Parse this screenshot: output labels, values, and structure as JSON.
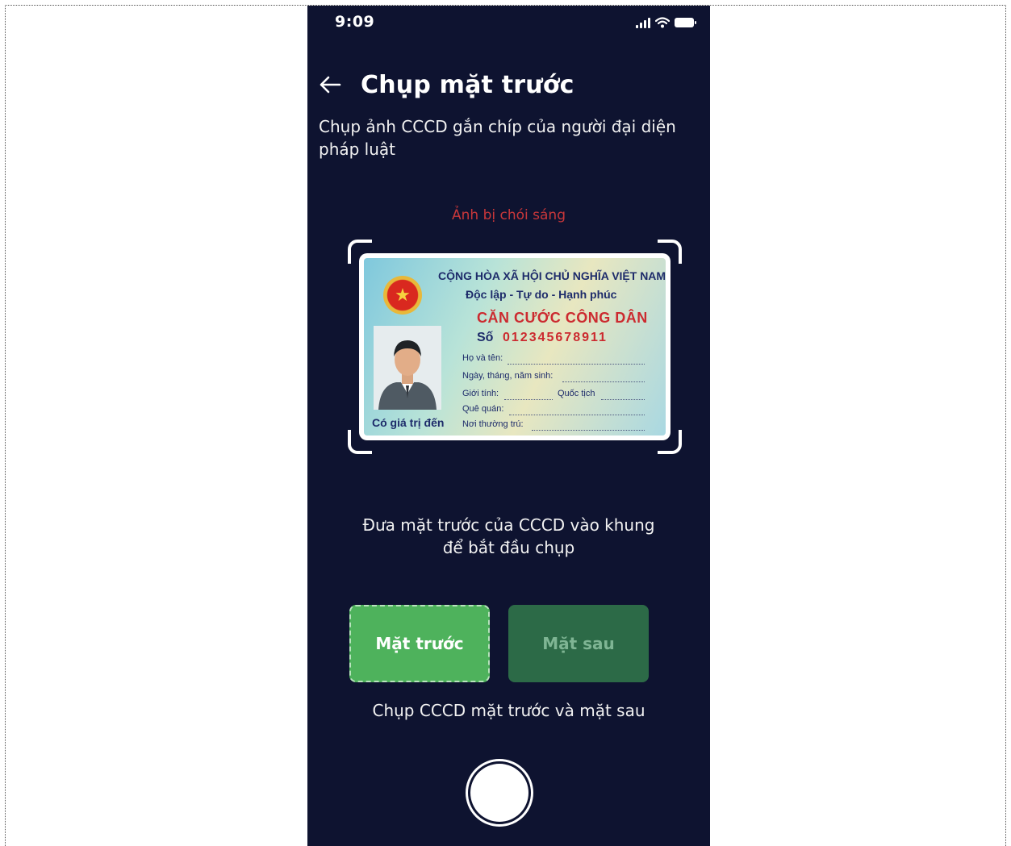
{
  "status_bar": {
    "time": "9:09",
    "icons": [
      "signal-icon",
      "wifi-icon",
      "battery-icon"
    ]
  },
  "header": {
    "back_icon": "arrow-left-icon",
    "title": "Chụp mặt trước"
  },
  "subtitle": "Chụp ảnh CCCD gắn chíp của người đại diện pháp luật",
  "warning": "Ảnh bị chói sáng",
  "id_card": {
    "republic": "CỘNG HÒA XÃ HỘI CHỦ NGHĨA VIỆT NAM",
    "motto": "Độc lập - Tự do - Hạnh phúc",
    "title": "CĂN CƯỚC CÔNG DÂN",
    "number_label": "Số",
    "number": "012345678911",
    "fields": {
      "name": "Họ và tên:",
      "dob": "Ngày, tháng, năm sinh:",
      "sex": "Giới tính:",
      "nationality": "Quốc tịch",
      "hometown": "Quê quán:",
      "residence": "Nơi thường trú:"
    },
    "valid_until": "Có giá trị đến"
  },
  "instruction": {
    "line1": "Đưa mặt trước của CCCD vào khung",
    "line2": "để bắt đầu chụp"
  },
  "buttons": {
    "front": "Mặt trước",
    "back": "Mặt sau"
  },
  "caption": "Chụp CCCD mặt trước và mặt sau",
  "colors": {
    "background": "#0e1330",
    "warning": "#c8373a",
    "front_button": "#4eb25c",
    "back_button": "#2c6a47"
  }
}
